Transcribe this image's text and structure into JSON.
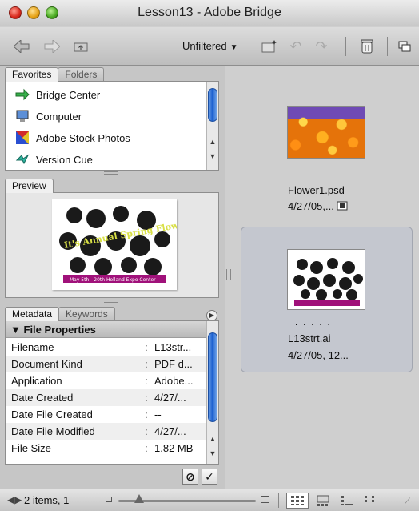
{
  "window": {
    "title": "Lesson13 - Adobe Bridge"
  },
  "toolbar": {
    "filter_label": "Unfiltered"
  },
  "favorites": {
    "tabs": [
      "Favorites",
      "Folders"
    ],
    "items": [
      {
        "label": "Bridge Center",
        "icon": "bridge-center-icon"
      },
      {
        "label": "Computer",
        "icon": "computer-icon"
      },
      {
        "label": "Adobe Stock Photos",
        "icon": "stock-photos-icon"
      },
      {
        "label": "Version Cue",
        "icon": "version-cue-icon"
      }
    ]
  },
  "preview": {
    "tab": "Preview",
    "image_text": {
      "banner": "It's Annual Spring Flower Show",
      "footer": "May 5th - 20th Holland Expo Center"
    }
  },
  "metadata": {
    "tabs": [
      "Metadata",
      "Keywords"
    ],
    "section": "File Properties",
    "rows": [
      {
        "key": "Filename",
        "value": "L13str..."
      },
      {
        "key": "Document Kind",
        "value": "PDF d..."
      },
      {
        "key": "Application",
        "value": "Adobe..."
      },
      {
        "key": "Date Created",
        "value": "4/27/..."
      },
      {
        "key": "Date File Created",
        "value": "--"
      },
      {
        "key": "Date File Modified",
        "value": "4/27/..."
      },
      {
        "key": "File Size",
        "value": "1.82 MB"
      }
    ]
  },
  "content": {
    "files": [
      {
        "name": "Flower1.psd",
        "date": "4/27/05,..."
      },
      {
        "name": "L13strt.ai",
        "date": "4/27/05, 12...",
        "rating": ". . . . ."
      }
    ]
  },
  "statusbar": {
    "text": "2 items, 1"
  },
  "colors": {
    "accent": "#1b5fcf",
    "selection": "#c4c7cf"
  }
}
